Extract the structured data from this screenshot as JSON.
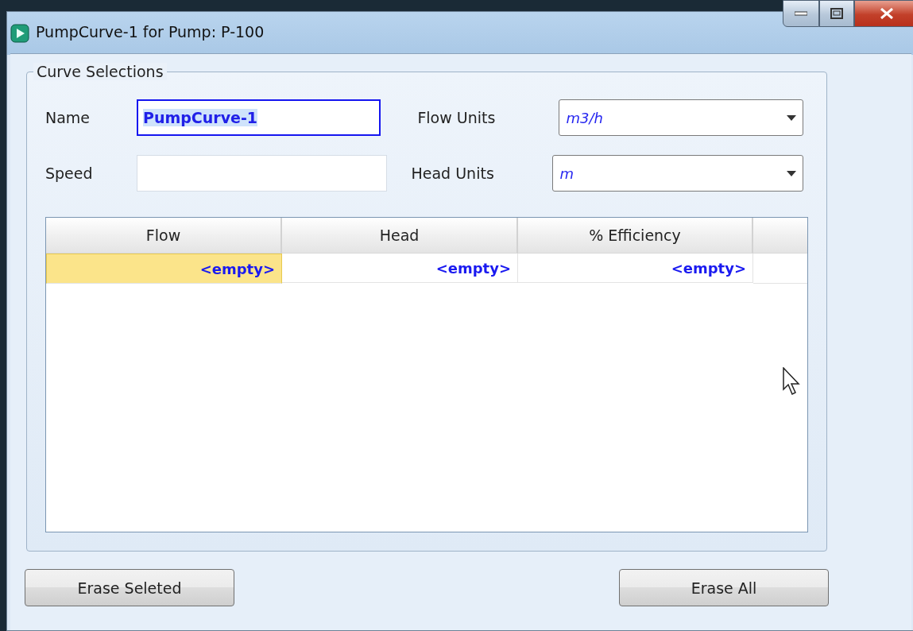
{
  "window": {
    "title": "PumpCurve-1 for Pump: P-100"
  },
  "group": {
    "title": "Curve Selections"
  },
  "fields": [
    {
      "label": "Name",
      "value": "PumpCurve-1",
      "focused": true
    },
    {
      "label": "Speed",
      "focused": false
    }
  ],
  "dropdowns": [
    {
      "label": "Flow Units",
      "value": "m3/h"
    },
    {
      "label": "Head Units",
      "value": "m"
    }
  ],
  "table": {
    "columns": [
      "Flow",
      "Head",
      "% Efficiency"
    ],
    "rows": [
      {
        "cells": [
          {
            "text": "<empty>",
            "selected": true
          },
          {
            "text": "<empty>",
            "selected": false
          },
          {
            "text": "<empty>",
            "selected": false
          }
        ]
      }
    ]
  },
  "buttons": [
    "Erase Seleted",
    "Erase All"
  ]
}
